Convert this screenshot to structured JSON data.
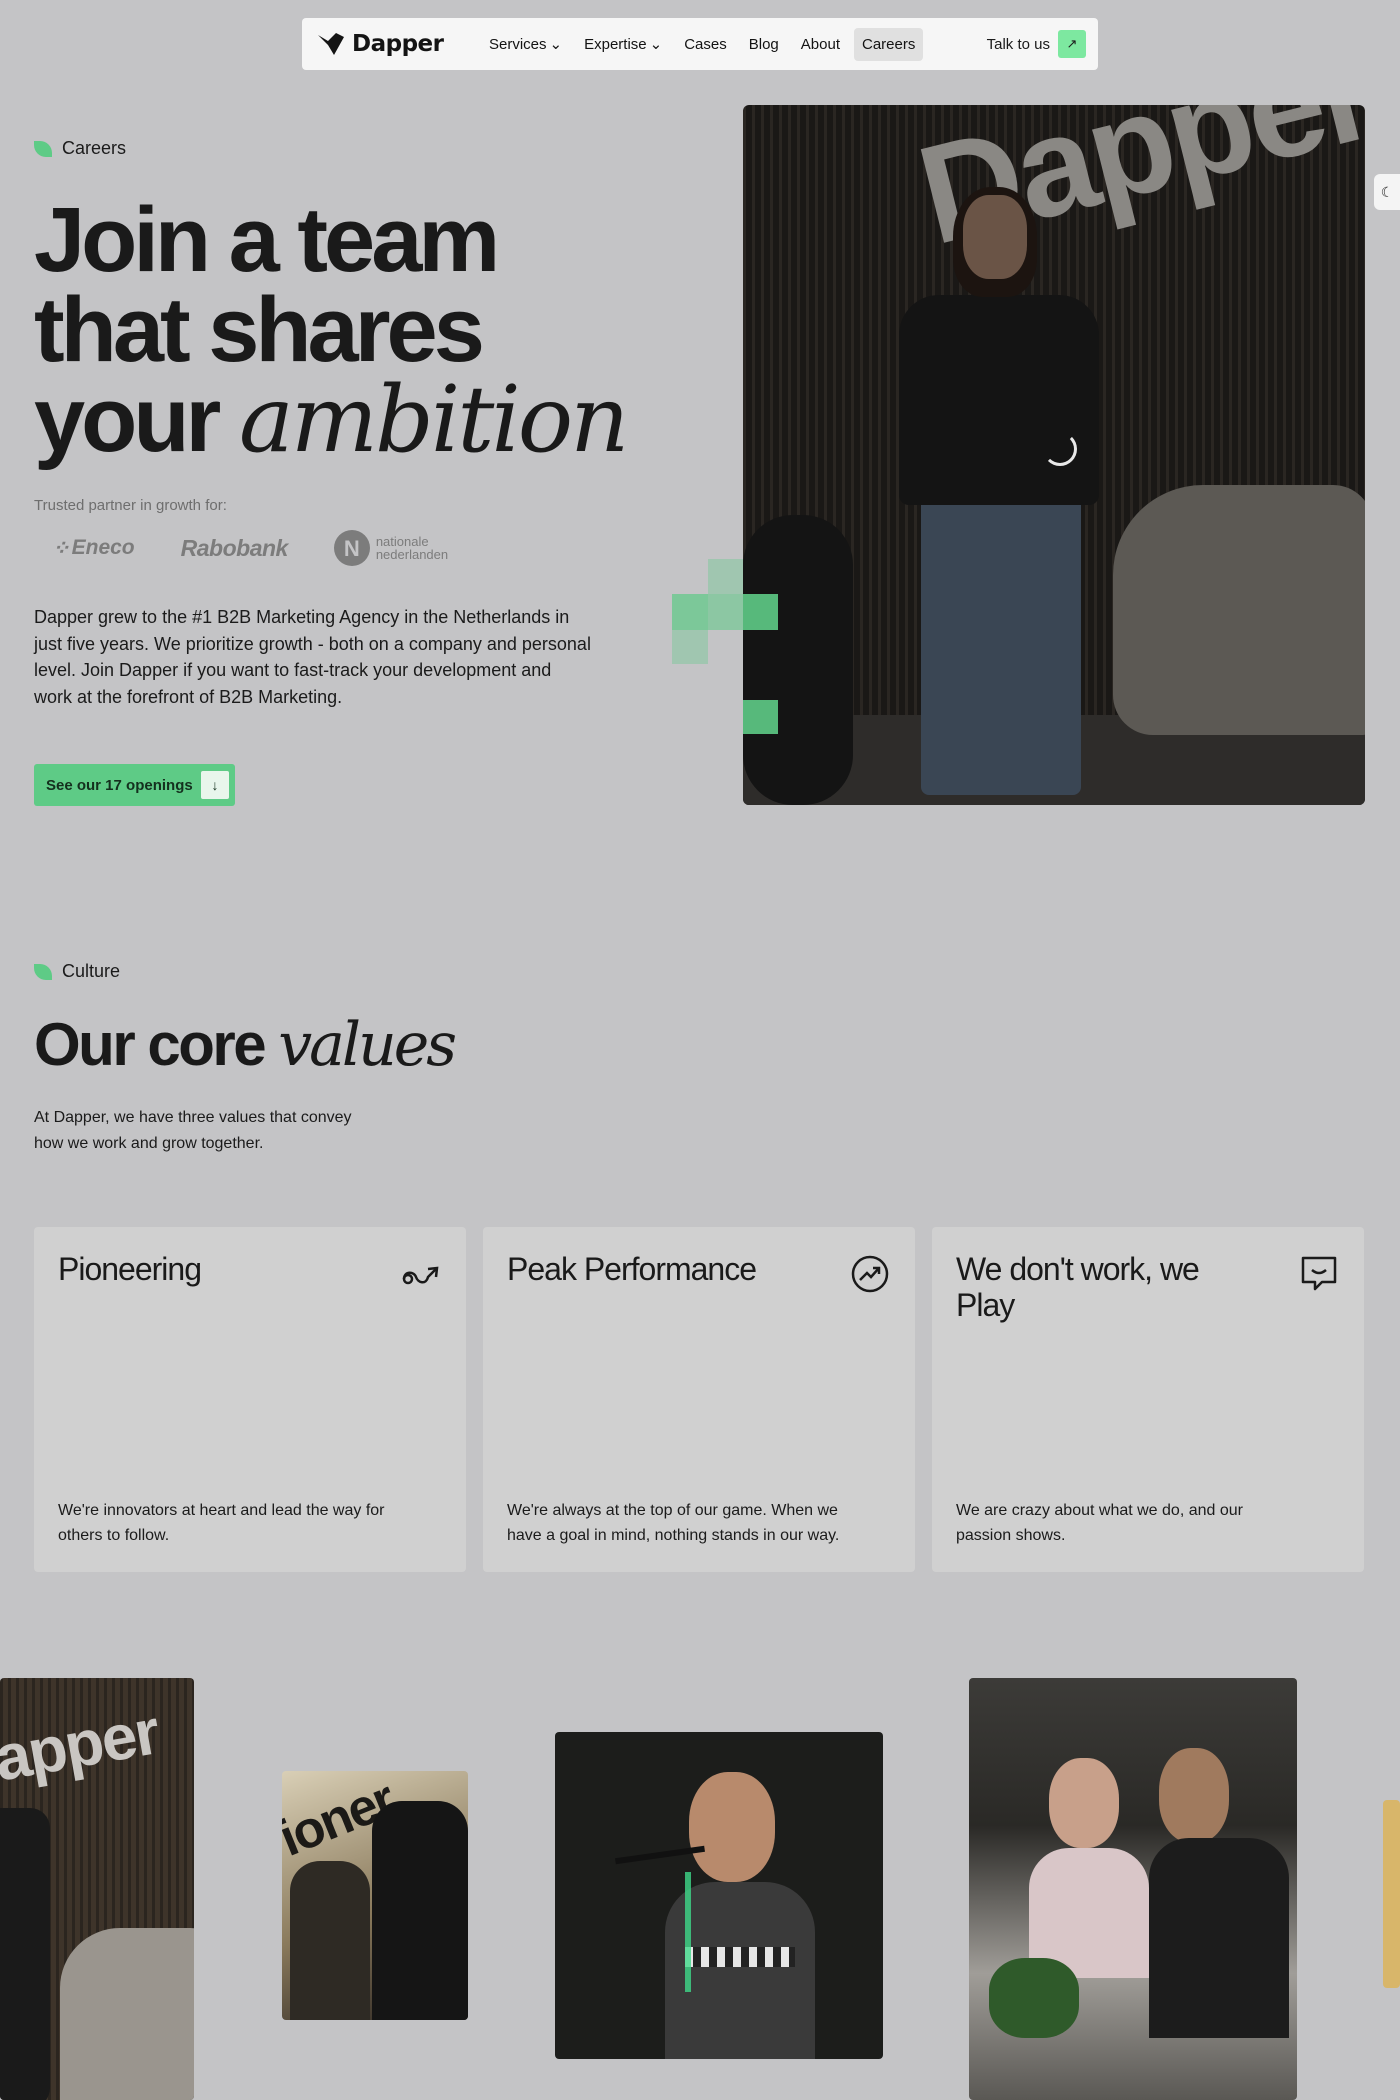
{
  "nav": {
    "logo": "Dapper",
    "links": [
      {
        "label": "Services",
        "dropdown": true
      },
      {
        "label": "Expertise",
        "dropdown": true
      },
      {
        "label": "Cases",
        "dropdown": false
      },
      {
        "label": "Blog",
        "dropdown": false
      },
      {
        "label": "About",
        "dropdown": false
      },
      {
        "label": "Careers",
        "dropdown": false,
        "active": true
      }
    ],
    "cta": "Talk to us",
    "cta_icon": "arrow-up-right-icon"
  },
  "hero": {
    "eyebrow": "Careers",
    "title_line1": "Join a team",
    "title_line2": "that shares",
    "title_line3_regular": "your",
    "title_line3_italic": "ambition",
    "trusted_label": "Trusted partner in growth for:",
    "partners": [
      "Eneco",
      "Rabobank",
      "nationale",
      "nederlanden"
    ],
    "copy": "Dapper grew to the #1 B2B Marketing Agency in the Netherlands in just five years. We prioritize growth - both on a company and personal level. Join Dapper if you want to fast-track your development and work at the forefront of B2B Marketing.",
    "button": "See our 17 openings",
    "button_icon": "arrow-down-icon",
    "photo_wall_text": "Dapper"
  },
  "culture": {
    "eyebrow": "Culture",
    "title_regular": "Our core",
    "title_italic": "values",
    "subtitle": "At Dapper, we have three values that convey how we work and grow together.",
    "cards": [
      {
        "title": "Pioneering",
        "icon": "squiggle-arrow-icon",
        "desc": "We're innovators at heart and lead the way for others to follow."
      },
      {
        "title": "Peak Performance",
        "icon": "trend-up-circle-icon",
        "desc": "We're always at the top of our game. When we have a goal in mind, nothing stands in our way."
      },
      {
        "title": "We don't work, we Play",
        "icon": "chat-bubble-icon",
        "desc": "We are crazy about what we do, and our passion shows."
      }
    ]
  },
  "gallery": {
    "photo1_wall_text": "apper",
    "photo2_wall_text": "ioner"
  },
  "colors": {
    "background": "#c4c4c6",
    "accent_green": "#5ecb86",
    "card": "#d0d0d0",
    "nav": "#f6f6f6"
  }
}
